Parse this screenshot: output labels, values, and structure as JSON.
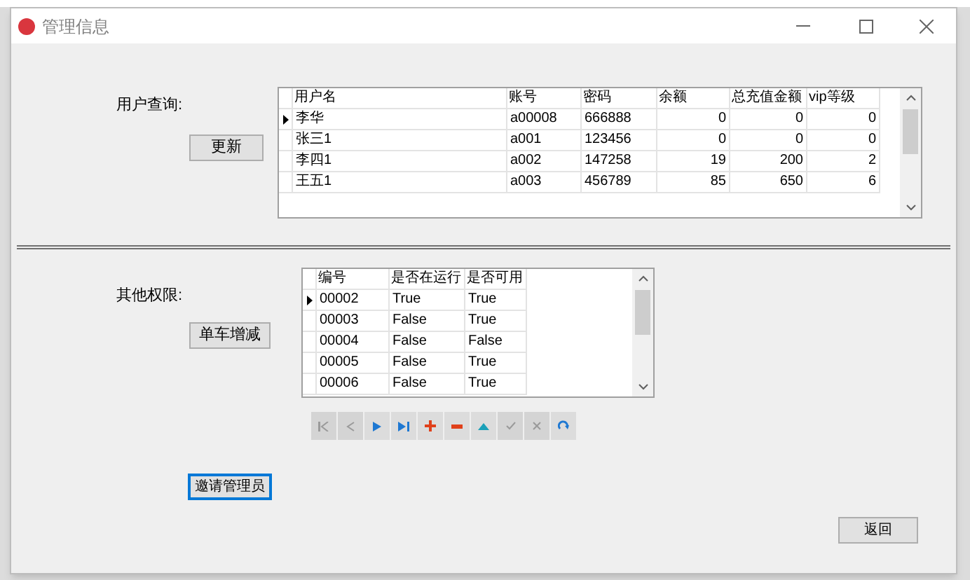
{
  "window": {
    "title": "管理信息"
  },
  "user_query": {
    "label": "用户查询:",
    "button": "更新",
    "grid": {
      "columns": [
        {
          "title": "用户名"
        },
        {
          "title": "账号"
        },
        {
          "title": "密码"
        },
        {
          "title": "余额"
        },
        {
          "title": "总充值金额"
        },
        {
          "title": "vip等级"
        }
      ],
      "rows": [
        {
          "selected": true,
          "cells": [
            "李华",
            "a00008",
            "666888",
            "0",
            "0",
            "0"
          ]
        },
        {
          "selected": false,
          "cells": [
            "张三1",
            "a001",
            "123456",
            "0",
            "0",
            "0"
          ]
        },
        {
          "selected": false,
          "cells": [
            "李四1",
            "a002",
            "147258",
            "19",
            "200",
            "2"
          ]
        },
        {
          "selected": false,
          "cells": [
            "王五1",
            "a003",
            "456789",
            "85",
            "650",
            "6"
          ]
        }
      ]
    }
  },
  "other_permissions": {
    "label": "其他权限:",
    "button": "单车增减",
    "grid": {
      "columns": [
        {
          "title": "编号"
        },
        {
          "title": "是否在运行"
        },
        {
          "title": "是否可用"
        }
      ],
      "rows": [
        {
          "selected": true,
          "cells": [
            "00002",
            "True",
            "True"
          ]
        },
        {
          "selected": false,
          "cells": [
            "00003",
            "False",
            "True"
          ]
        },
        {
          "selected": false,
          "cells": [
            "00004",
            "False",
            "False"
          ]
        },
        {
          "selected": false,
          "cells": [
            "00005",
            "False",
            "True"
          ]
        },
        {
          "selected": false,
          "cells": [
            "00006",
            "False",
            "True"
          ]
        }
      ]
    },
    "navigator": [
      {
        "kind": "first",
        "disabled": true
      },
      {
        "kind": "prior",
        "disabled": true
      },
      {
        "kind": "next",
        "disabled": false
      },
      {
        "kind": "last",
        "disabled": false
      },
      {
        "kind": "insert",
        "disabled": false
      },
      {
        "kind": "delete",
        "disabled": false
      },
      {
        "kind": "edit",
        "disabled": false
      },
      {
        "kind": "post",
        "disabled": true
      },
      {
        "kind": "cancel",
        "disabled": true
      },
      {
        "kind": "refresh",
        "disabled": false
      }
    ]
  },
  "invite_button": {
    "label": "邀请管理员",
    "focused": true
  },
  "back_button": {
    "label": "返回",
    "focused": false
  }
}
